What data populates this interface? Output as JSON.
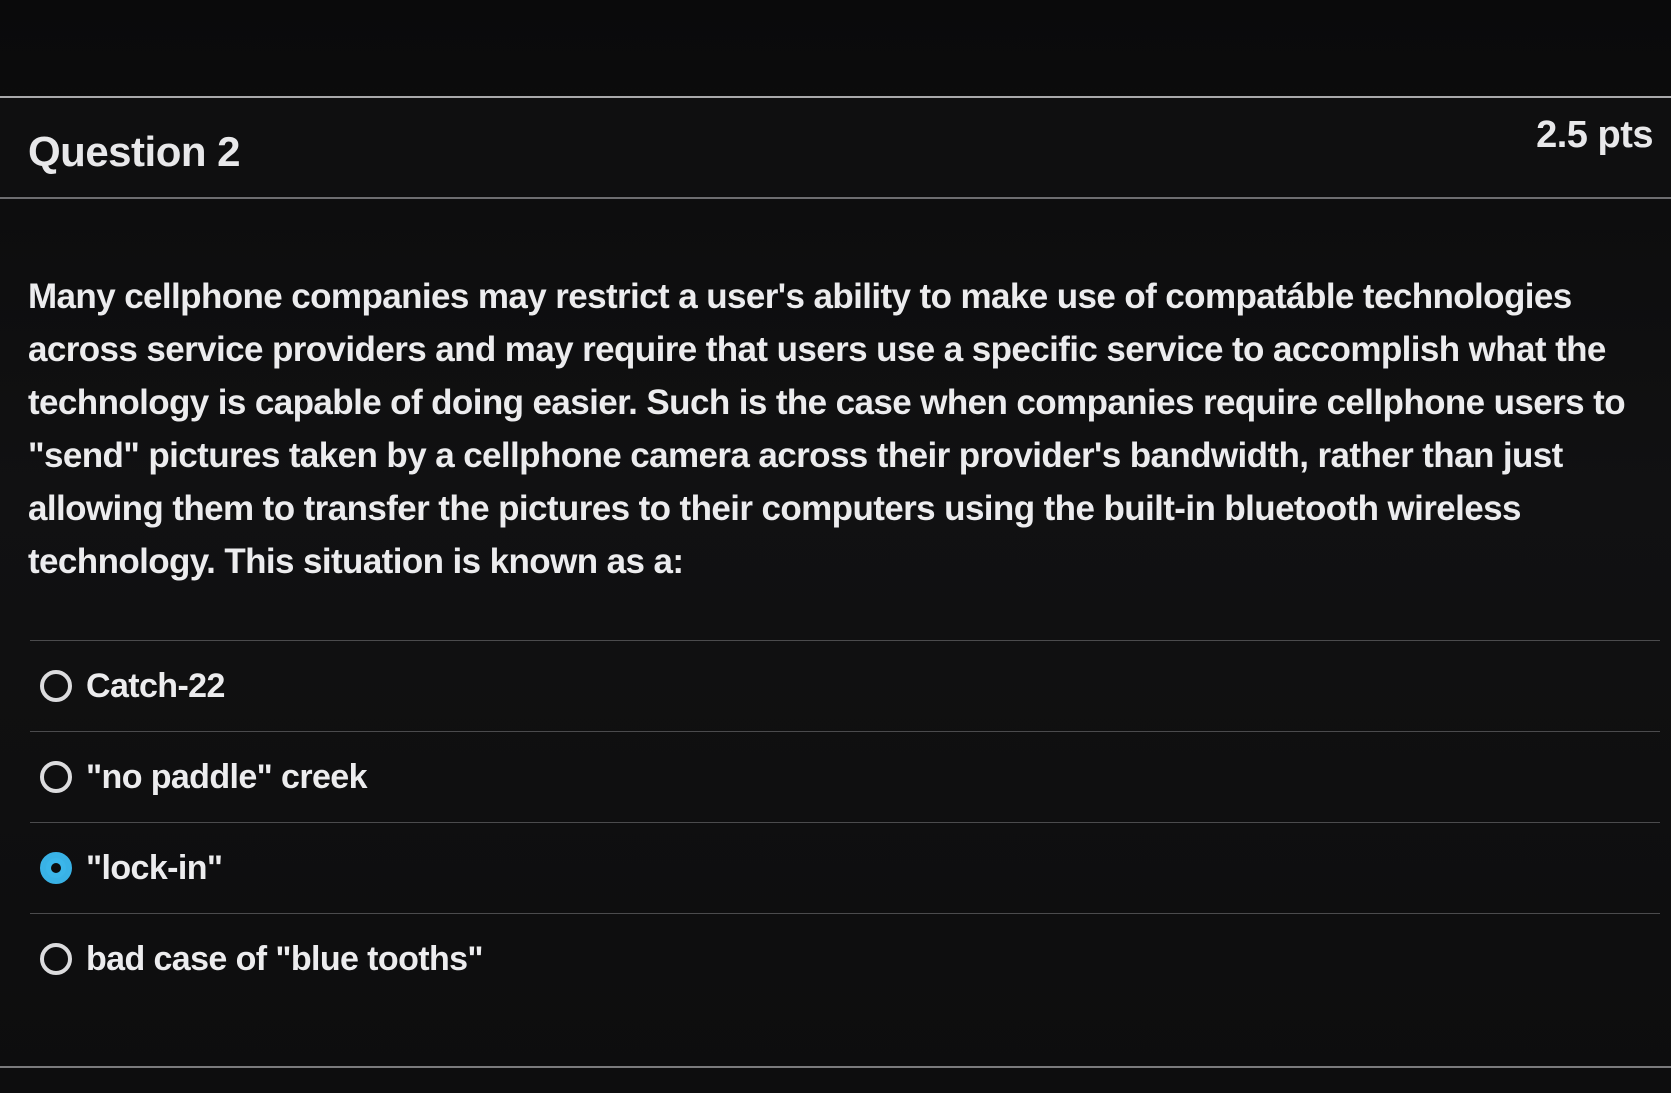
{
  "question": {
    "title": "Question 2",
    "points": "2.5 pts",
    "text": "Many cellphone companies may restrict a user's ability to make use of compatáble technologies across service providers and may require that users use a specific service to accomplish what the technology is capable of doing easier.  Such is the case when companies require cellphone users to \"send\" pictures taken by a cellphone camera across their provider's bandwidth, rather than just allowing them to transfer the pictures to their computers using the built-in bluetooth wireless technology.  This situation is known as a:"
  },
  "answers": [
    {
      "label": "Catch-22",
      "selected": false
    },
    {
      "label": "\"no paddle\" creek",
      "selected": false
    },
    {
      "label": "\"lock-in\"",
      "selected": true
    },
    {
      "label": "bad case of \"blue tooths\"",
      "selected": false
    }
  ],
  "colors": {
    "background": "#0c0c0d",
    "text": "#ececee",
    "accent": "#3bb6ea",
    "divider": "#4b4b4d"
  }
}
